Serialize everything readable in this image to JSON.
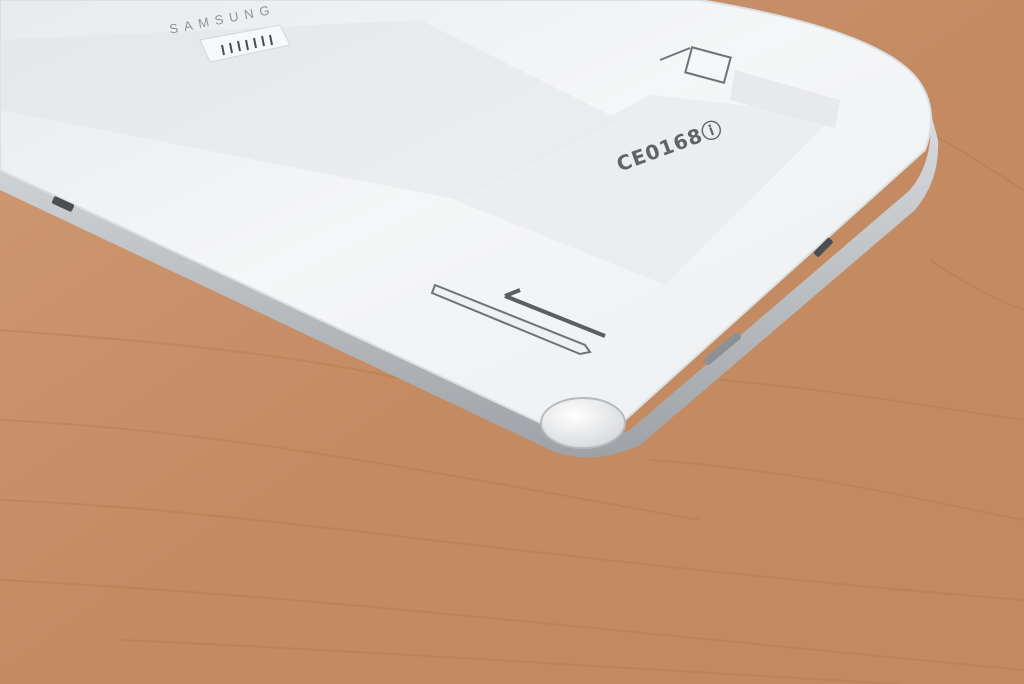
{
  "scene": {
    "brand": "SAMSUNG",
    "cert_mark": "CE0168ⓘ",
    "colors": {
      "table": "#c9916a",
      "table_dark": "#b07a55",
      "device_body": "#f1f2f4",
      "device_edge": "#b7babd",
      "label": "#e9ebee"
    }
  }
}
